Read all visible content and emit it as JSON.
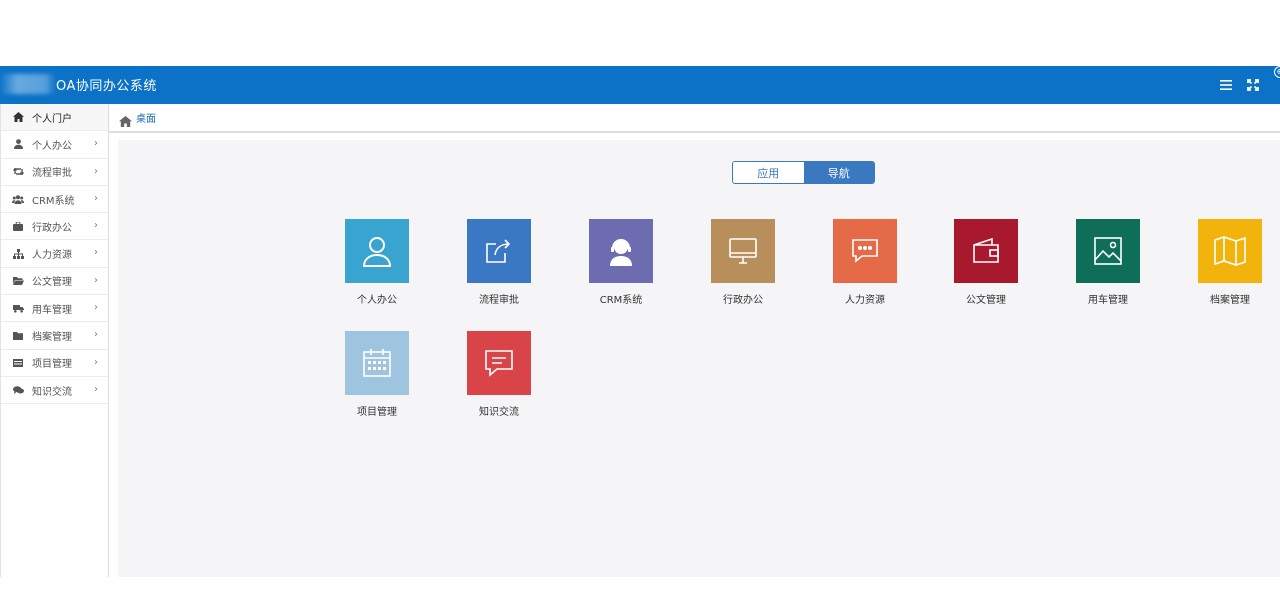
{
  "header": {
    "title": "OA协同办公系统",
    "menu_icon": "menu-icon",
    "fullscreen_icon": "fullscreen-icon"
  },
  "sidebar": {
    "items": [
      {
        "label": "个人门户",
        "icon": "home-icon",
        "active": true,
        "has_arrow": false
      },
      {
        "label": "个人办公",
        "icon": "user-icon",
        "has_arrow": true
      },
      {
        "label": "流程审批",
        "icon": "retweet-icon",
        "has_arrow": true
      },
      {
        "label": "CRM系统",
        "icon": "users-icon",
        "has_arrow": true
      },
      {
        "label": "行政办公",
        "icon": "briefcase-icon",
        "has_arrow": true
      },
      {
        "label": "人力资源",
        "icon": "sitemap-icon",
        "has_arrow": true
      },
      {
        "label": "公文管理",
        "icon": "folder-open-icon",
        "has_arrow": true
      },
      {
        "label": "用车管理",
        "icon": "truck-icon",
        "has_arrow": true
      },
      {
        "label": "档案管理",
        "icon": "folder-icon",
        "has_arrow": true
      },
      {
        "label": "项目管理",
        "icon": "list-icon",
        "has_arrow": true
      },
      {
        "label": "知识交流",
        "icon": "comments-icon",
        "has_arrow": true
      }
    ],
    "arrow": "›"
  },
  "breadcrumb": {
    "icon": "home-icon",
    "label": "桌面"
  },
  "toggle": {
    "left": "应用",
    "right": "导航",
    "active": "right"
  },
  "tiles": [
    {
      "label": "个人办公",
      "color": "#3aa4d1",
      "icon": "user-outline-icon"
    },
    {
      "label": "流程审批",
      "color": "#3b78c3",
      "icon": "share-square-icon"
    },
    {
      "label": "CRM系统",
      "color": "#6d6cb1",
      "icon": "customer-service-icon"
    },
    {
      "label": "行政办公",
      "color": "#b88e5b",
      "icon": "monitor-icon"
    },
    {
      "label": "人力资源",
      "color": "#e56a48",
      "icon": "chat-dots-icon"
    },
    {
      "label": "公文管理",
      "color": "#a8192e",
      "icon": "wallet-icon"
    },
    {
      "label": "用车管理",
      "color": "#0f6e58",
      "icon": "picture-icon"
    },
    {
      "label": "档案管理",
      "color": "#f2b40c",
      "icon": "map-icon"
    },
    {
      "label": "项目管理",
      "color": "#9ec4e0",
      "icon": "calendar-icon"
    },
    {
      "label": "知识交流",
      "color": "#d94449",
      "icon": "message-icon"
    }
  ]
}
